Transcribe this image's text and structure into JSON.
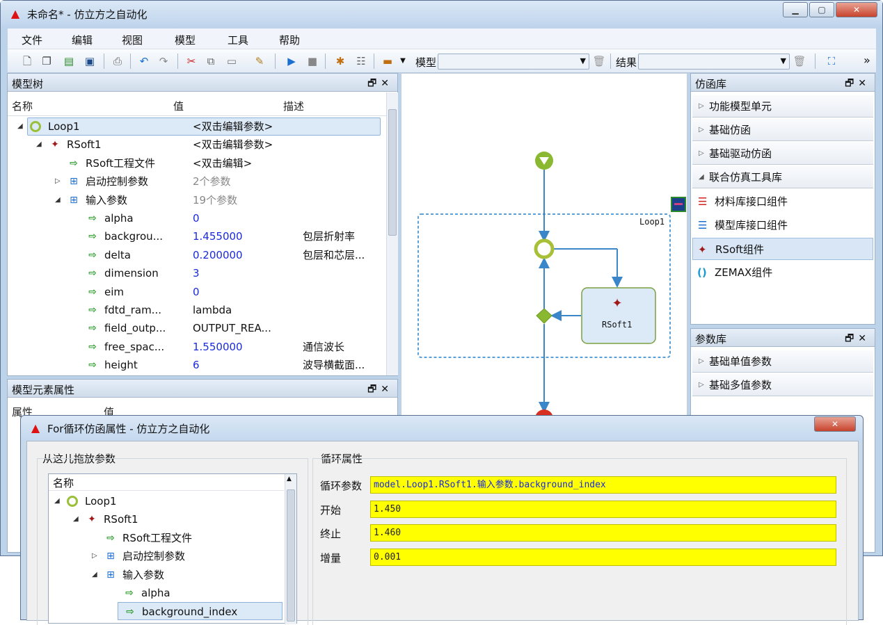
{
  "window": {
    "title": "未命名* - 仿立方之自动化"
  },
  "menu": [
    "文件",
    "编辑",
    "视图",
    "模型",
    "工具",
    "帮助"
  ],
  "toolbar": {
    "model_label": "模型",
    "result_label": "结果",
    "more": "»"
  },
  "model_tree": {
    "title": "模型树",
    "columns": [
      "名称",
      "值",
      "描述"
    ],
    "rows": [
      {
        "name": "Loop1",
        "value": "<双击编辑参数>",
        "desc": "",
        "icon": "loop-icon"
      },
      {
        "name": "RSoft1",
        "value": "<双击编辑参数>",
        "desc": "",
        "icon": "rsoft-icon"
      },
      {
        "name": "RSoft工程文件",
        "value": "<双击编辑>",
        "desc": "",
        "icon": "param-icon"
      },
      {
        "name": "启动控制参数",
        "value": "2个参数",
        "desc": "",
        "icon": "group-icon"
      },
      {
        "name": "输入参数",
        "value": "19个参数",
        "desc": "",
        "icon": "group-icon"
      },
      {
        "name": "alpha",
        "value": "0",
        "desc": "",
        "icon": "param-icon"
      },
      {
        "name": "backgrou...",
        "value": "1.455000",
        "desc": "包层折射率",
        "icon": "param-icon"
      },
      {
        "name": "delta",
        "value": "0.200000",
        "desc": "包层和芯层...",
        "icon": "param-icon"
      },
      {
        "name": "dimension",
        "value": "3",
        "desc": "",
        "icon": "param-icon"
      },
      {
        "name": "eim",
        "value": "0",
        "desc": "",
        "icon": "param-icon"
      },
      {
        "name": "fdtd_ram...",
        "value": "lambda",
        "desc": "",
        "icon": "param-icon"
      },
      {
        "name": "field_outp...",
        "value": "OUTPUT_REA...",
        "desc": "",
        "icon": "param-icon"
      },
      {
        "name": "free_spac...",
        "value": "1.550000",
        "desc": "通信波长",
        "icon": "param-icon"
      },
      {
        "name": "height",
        "value": "6",
        "desc": "波导横截面...",
        "icon": "param-icon"
      }
    ]
  },
  "element_props": {
    "title": "模型元素属性",
    "columns": [
      "属性",
      "值"
    ]
  },
  "canvas": {
    "loop_label": "Loop1",
    "node_label": "RSoft1"
  },
  "sim_lib": {
    "title": "仿函库",
    "categories": [
      "功能模型单元",
      "基础仿函",
      "基础驱动仿函",
      "联合仿真工具库"
    ],
    "items": [
      "材料库接口组件",
      "模型库接口组件",
      "RSoft组件",
      "ZEMAX组件"
    ]
  },
  "param_lib": {
    "title": "参数库",
    "categories": [
      "基础单值参数",
      "基础多值参数"
    ]
  },
  "dialog": {
    "title": "For循环仿函属性 - 仿立方之自动化",
    "drag_group": "从这儿拖放参数",
    "tree_header": "名称",
    "tree": [
      "Loop1",
      "RSoft1",
      "RSoft工程文件",
      "启动控制参数",
      "输入参数",
      "alpha",
      "background_index"
    ],
    "loop_group": "循环属性",
    "fields": [
      {
        "label": "循环参数",
        "value": "model.Loop1.RSoft1.输入参数.background_index"
      },
      {
        "label": "开始",
        "value": "1.450"
      },
      {
        "label": "终止",
        "value": "1.460"
      },
      {
        "label": "增量",
        "value": "0.001"
      }
    ]
  }
}
